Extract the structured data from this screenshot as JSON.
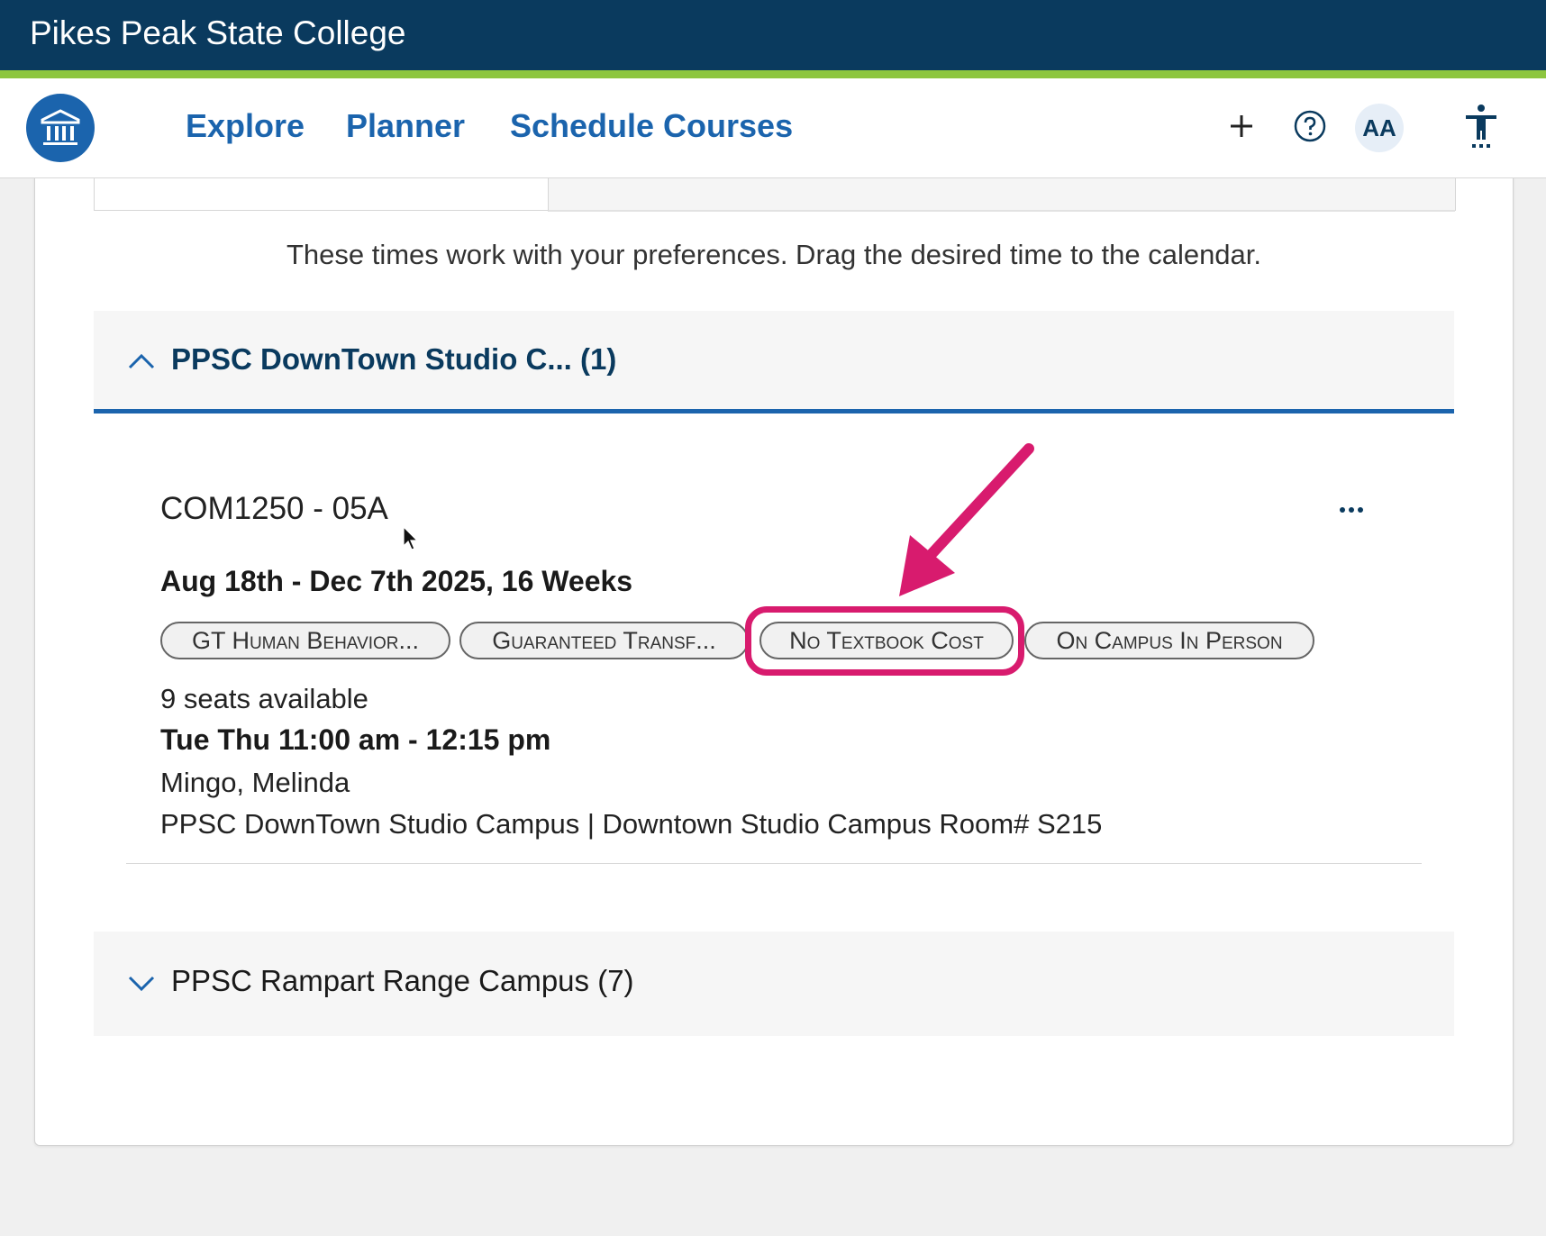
{
  "header": {
    "college_name": "Pikes Peak State College"
  },
  "nav": {
    "links": [
      "Explore",
      "Planner",
      "Schedule Courses"
    ],
    "avatar_initials": "AA",
    "plus_label": "+"
  },
  "results": {
    "instructions": "These times work with your preferences. Drag the desired time to the calendar.",
    "groups": [
      {
        "title": "PPSC DownTown Studio C... (1)",
        "expanded": true
      },
      {
        "title": "PPSC Rampart Range Campus (7)",
        "expanded": false
      }
    ],
    "section": {
      "code": "COM1250 - 05A",
      "dates": "Aug 18th - Dec 7th 2025, 16 Weeks",
      "tags": [
        "GT Human Behavior...",
        "Guaranteed Transf...",
        "No Textbook Cost",
        "On Campus In Person"
      ],
      "seats": "9 seats available",
      "meeting_time": "Tue Thu 11:00 am - 12:15 pm",
      "instructor": "Mingo, Melinda",
      "location": "PPSC DownTown Studio Campus | Downtown Studio Campus Room# S215"
    }
  },
  "annotation": {
    "color": "#d81b6e",
    "highlighted_tag": "No Textbook Cost"
  },
  "colors": {
    "brand_navy": "#0a3a5e",
    "accent_green": "#8dc63f",
    "link_blue": "#1b64ad"
  },
  "icons": [
    "institution-logo-icon",
    "plus-icon",
    "help-icon",
    "accessibility-icon",
    "more-options-icon",
    "chevron-up-icon",
    "chevron-down-icon",
    "mouse-pointer-icon",
    "annotation-arrow-icon"
  ]
}
